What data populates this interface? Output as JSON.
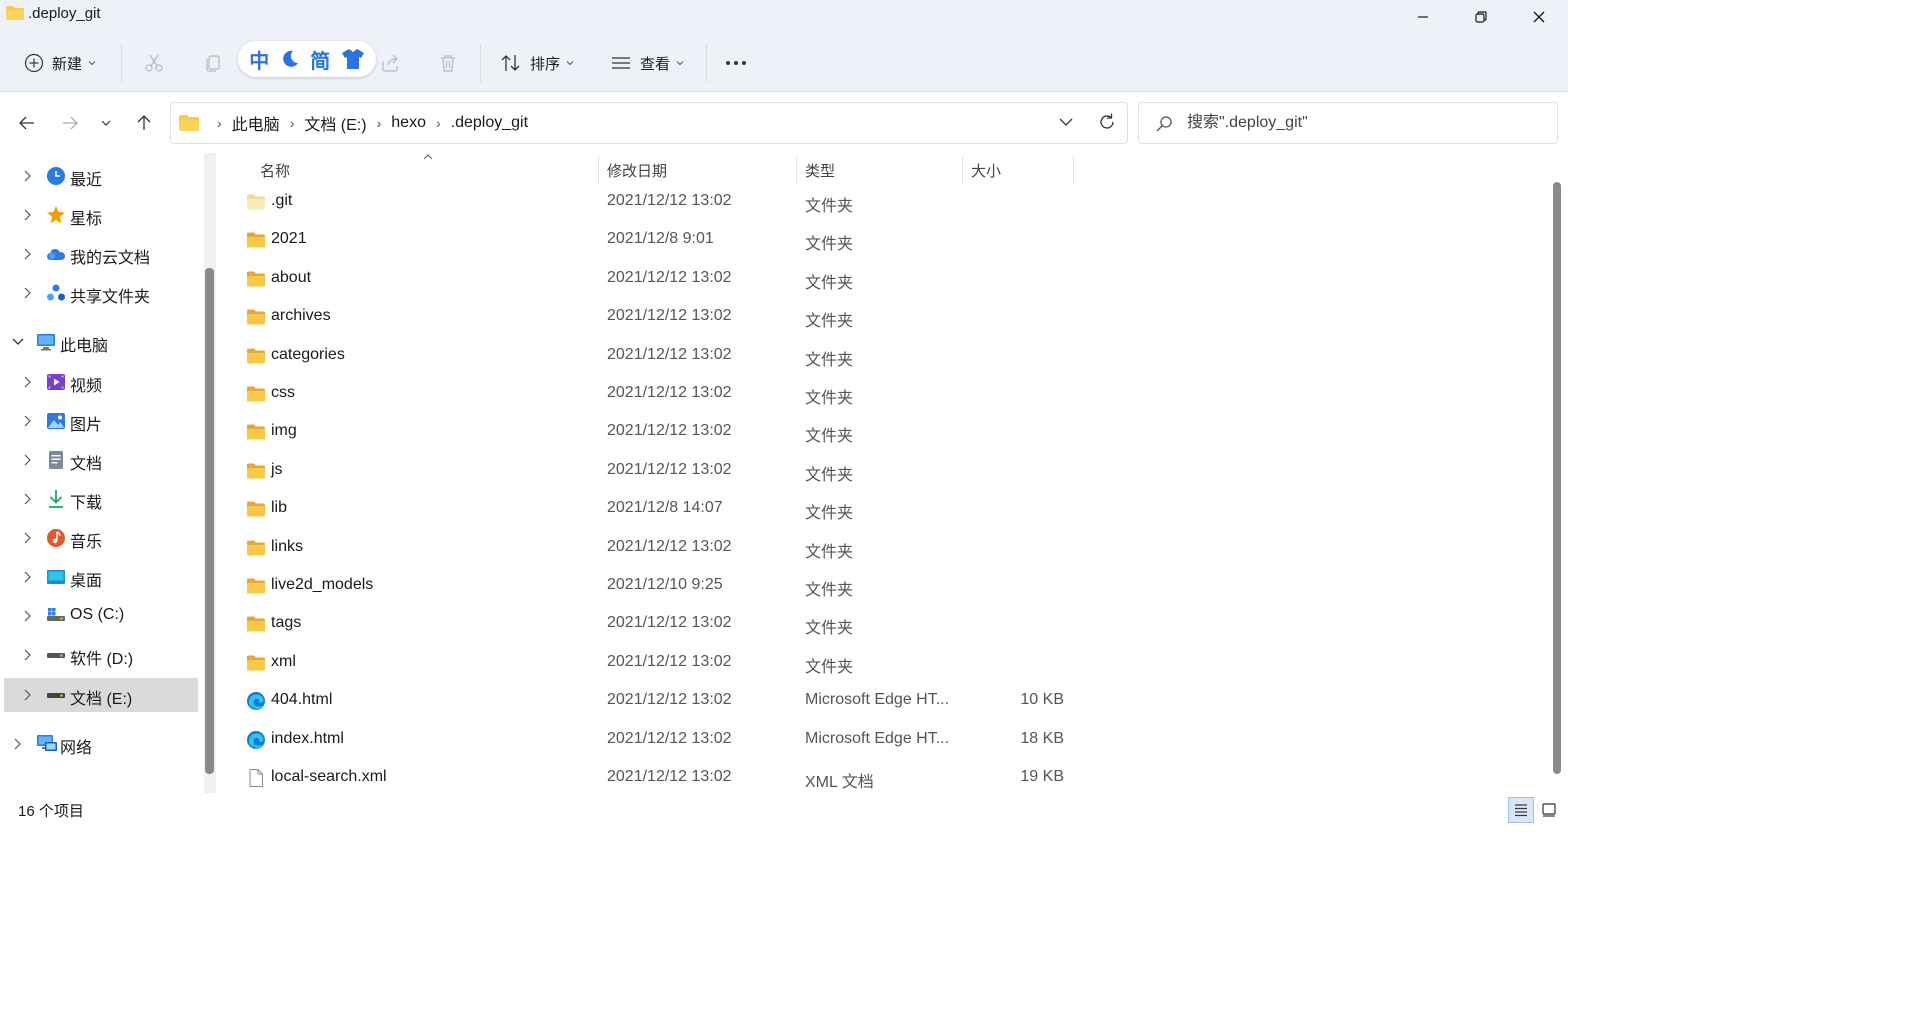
{
  "window": {
    "title": ".deploy_git",
    "minimize_icon": "minimize-icon",
    "maximize_icon": "restore-icon",
    "close_icon": "close-icon"
  },
  "toolbar": {
    "new_label": "新建",
    "sort_label": "排序",
    "view_label": "查看",
    "ime": [
      "中",
      "☽",
      "简",
      "shirt"
    ],
    "icons": [
      "plus-circle-icon",
      "cut-icon",
      "copy-icon",
      "share-icon",
      "delete-icon",
      "sort-icon",
      "view-icon",
      "more-icon"
    ]
  },
  "nav": {
    "breadcrumb": [
      "此电脑",
      "文档 (E:)",
      "hexo",
      ".deploy_git"
    ],
    "search_placeholder": "搜索\".deploy_git\""
  },
  "sidebar": {
    "items": [
      {
        "label": "最近",
        "icon": "clock-icon",
        "color": "#2b7be0"
      },
      {
        "label": "星标",
        "icon": "star-icon",
        "color": "#f2a100"
      },
      {
        "label": "我的云文档",
        "icon": "cloud-icon",
        "color": "#2b7be0"
      },
      {
        "label": "共享文件夹",
        "icon": "shared-folder-icon",
        "color": "#2b7be0"
      },
      {
        "label": "此电脑",
        "icon": "computer-icon",
        "color": "#2b7be0"
      },
      {
        "label": "视频",
        "icon": "video-icon",
        "color": "#7a3fd1"
      },
      {
        "label": "图片",
        "icon": "picture-icon",
        "color": "#2b7be0"
      },
      {
        "label": "文档",
        "icon": "document-icon",
        "color": "#7d8a99"
      },
      {
        "label": "下载",
        "icon": "download-icon",
        "color": "#1aa56a"
      },
      {
        "label": "音乐",
        "icon": "music-icon",
        "color": "#e0582b"
      },
      {
        "label": "桌面",
        "icon": "desktop-icon",
        "color": "#1a8fd6"
      },
      {
        "label": "OS (C:)",
        "icon": "drive-c-icon",
        "color": "#555555"
      },
      {
        "label": "软件 (D:)",
        "icon": "drive-icon",
        "color": "#555555"
      },
      {
        "label": "文档 (E:)",
        "icon": "drive-icon",
        "color": "#555555"
      },
      {
        "label": "网络",
        "icon": "network-icon",
        "color": "#2b7be0"
      }
    ]
  },
  "list": {
    "columns": [
      "名称",
      "修改日期",
      "类型",
      "大小"
    ],
    "rows": [
      {
        "name": ".git",
        "date": "2021/12/12 13:02",
        "type": "文件夹",
        "size": "",
        "icon": "folder-light-icon"
      },
      {
        "name": "2021",
        "date": "2021/12/8 9:01",
        "type": "文件夹",
        "size": "",
        "icon": "folder-icon"
      },
      {
        "name": "about",
        "date": "2021/12/12 13:02",
        "type": "文件夹",
        "size": "",
        "icon": "folder-icon"
      },
      {
        "name": "archives",
        "date": "2021/12/12 13:02",
        "type": "文件夹",
        "size": "",
        "icon": "folder-icon"
      },
      {
        "name": "categories",
        "date": "2021/12/12 13:02",
        "type": "文件夹",
        "size": "",
        "icon": "folder-icon"
      },
      {
        "name": "css",
        "date": "2021/12/12 13:02",
        "type": "文件夹",
        "size": "",
        "icon": "folder-icon"
      },
      {
        "name": "img",
        "date": "2021/12/12 13:02",
        "type": "文件夹",
        "size": "",
        "icon": "folder-icon"
      },
      {
        "name": "js",
        "date": "2021/12/12 13:02",
        "type": "文件夹",
        "size": "",
        "icon": "folder-icon"
      },
      {
        "name": "lib",
        "date": "2021/12/8 14:07",
        "type": "文件夹",
        "size": "",
        "icon": "folder-icon"
      },
      {
        "name": "links",
        "date": "2021/12/12 13:02",
        "type": "文件夹",
        "size": "",
        "icon": "folder-icon"
      },
      {
        "name": "live2d_models",
        "date": "2021/12/10 9:25",
        "type": "文件夹",
        "size": "",
        "icon": "folder-icon"
      },
      {
        "name": "tags",
        "date": "2021/12/12 13:02",
        "type": "文件夹",
        "size": "",
        "icon": "folder-icon"
      },
      {
        "name": "xml",
        "date": "2021/12/12 13:02",
        "type": "文件夹",
        "size": "",
        "icon": "folder-icon"
      },
      {
        "name": "404.html",
        "date": "2021/12/12 13:02",
        "type": "Microsoft Edge HT...",
        "size": "10 KB",
        "icon": "edge-icon"
      },
      {
        "name": "index.html",
        "date": "2021/12/12 13:02",
        "type": "Microsoft Edge HT...",
        "size": "18 KB",
        "icon": "edge-icon"
      },
      {
        "name": "local-search.xml",
        "date": "2021/12/12 13:02",
        "type": "XML 文档",
        "size": "19 KB",
        "icon": "file-icon"
      }
    ]
  },
  "status": {
    "count": "16 个项目"
  },
  "colors": {
    "folder": "#f7c948",
    "folder_dark": "#e8a932",
    "accent": "#2b73e0"
  }
}
